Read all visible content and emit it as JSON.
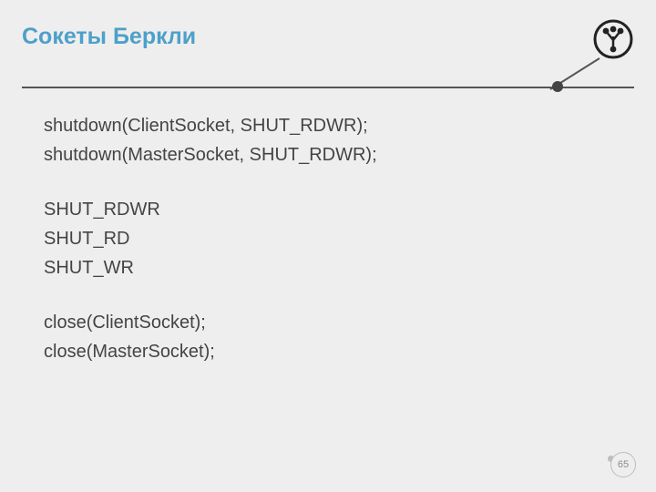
{
  "title": "Сокеты Беркли",
  "lines": [
    "shutdown(ClientSocket, SHUT_RDWR);",
    "shutdown(MasterSocket, SHUT_RDWR);",
    "",
    "SHUT_RDWR",
    "SHUT_RD",
    "SHUT_WR",
    "",
    "close(ClientSocket);",
    "close(MasterSocket);"
  ],
  "page_number": "65"
}
